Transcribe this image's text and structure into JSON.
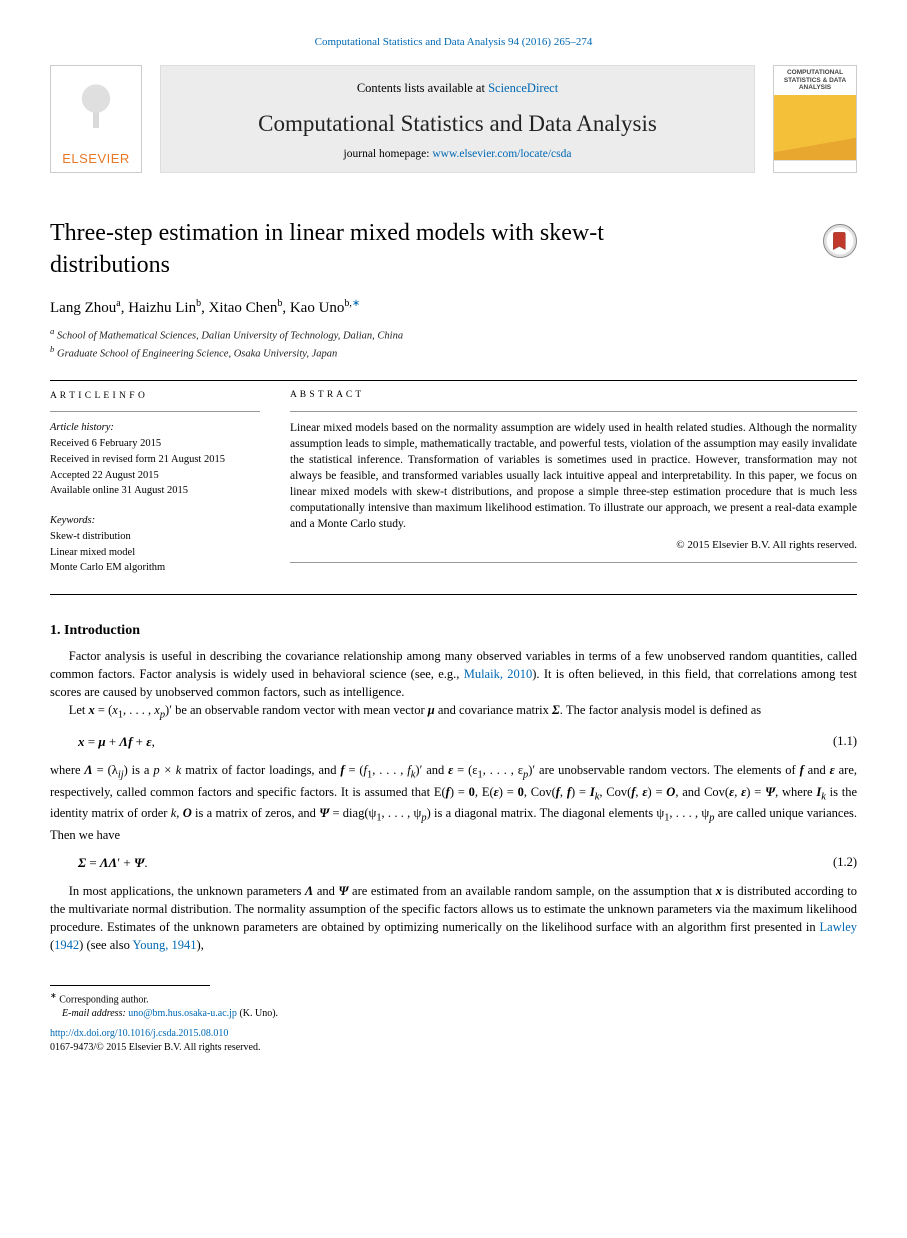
{
  "header_link": "Computational Statistics and Data Analysis 94 (2016) 265–274",
  "banner": {
    "elsevier_word": "ELSEVIER",
    "contents_prefix": "Contents lists available at ",
    "contents_link": "ScienceDirect",
    "journal_name": "Computational Statistics and Data Analysis",
    "homepage_prefix": "journal homepage: ",
    "homepage_link": "www.elsevier.com/locate/csda",
    "cover_text": "COMPUTATIONAL STATISTICS & DATA ANALYSIS"
  },
  "title": "Three-step estimation in linear mixed models with skew-t distributions",
  "authors": {
    "a1_name": "Lang Zhou",
    "a1_sup": "a",
    "a2_name": "Haizhu Lin",
    "a2_sup": "b",
    "a3_name": "Xitao Chen",
    "a3_sup": "b",
    "a4_name": "Kao Uno",
    "a4_sup": "b,",
    "a4_star": "∗"
  },
  "affiliations": {
    "a": "School of Mathematical Sciences, Dalian University of Technology, Dalian, China",
    "b": "Graduate School of Engineering Science, Osaka University, Japan"
  },
  "history": {
    "header": "A R T I C L E   I N F O",
    "line1": "Article history:",
    "line2": "Received 6 February 2015",
    "line3": "Received in revised form 21 August 2015",
    "line4": "Accepted 22 August 2015",
    "line5": "Available online 31 August 2015",
    "kw_header": "Keywords:",
    "kw1": "Skew-t distribution",
    "kw2": "Linear mixed model",
    "kw3": "Monte Carlo EM algorithm"
  },
  "abstract": {
    "header": "A B S T R A C T",
    "text": "Linear mixed models based on the normality assumption are widely used in health related studies. Although the normality assumption leads to simple, mathematically tractable, and powerful tests, violation of the assumption may easily invalidate the statistical inference. Transformation of variables is sometimes used in practice. However, transformation may not always be feasible, and transformed variables usually lack intuitive appeal and interpretability. In this paper, we focus on linear mixed models with skew-t distributions, and propose a simple three-step estimation procedure that is much less computationally intensive than maximum likelihood estimation. To illustrate our approach, we present a real-data example and a Monte Carlo study.",
    "copyright": "© 2015 Elsevier B.V. All rights reserved."
  },
  "section1": {
    "heading": "1. Introduction",
    "p1a": "Factor analysis is useful in describing the covariance relationship among many observed variables in terms of a few unobserved random quantities, called common factors. Factor analysis is widely used in behavioral science (see, e.g., ",
    "p1_cite1": "Mulaik, 2010",
    "p1b": "). It is often believed, in this field, that correlations among test scores are caused by unobserved common factors, such as intelligence."
  },
  "model": {
    "intro": "Let ",
    "x_def": " be an observable random vector with mean vector ",
    "mu_sym": "μ",
    "cov_sym": " and covariance matrix ",
    "sigma_sym": "Σ",
    "model_text": ". The factor analysis model is defined as",
    "eq": "x = μ + Λf + ε,",
    "eq_num": "(1.1)"
  },
  "p2": {
    "a": "where ",
    "lambda": "Λ = (λij)",
    "b": " is a ",
    "pk": "p × k",
    "c": " matrix of factor loadings, and ",
    "f": "f = (f1, . . . , fk)′",
    "d": " and ",
    "eps": "ε = (ε1, . . . , εp)′",
    "e": " are unobservable random vectors. The elements of ",
    "f2": "f",
    "g": " and ",
    "eps2": "ε",
    "h": " are, respectively, called common factors and specific factors. It is assumed that ",
    "ef": "E(f) = 0",
    "comma1": ", ",
    "ee": "E(ε) = 0",
    "comma2": ", ",
    "cff": "Cov(f, f) = Ik",
    "comma3": ", ",
    "cfe": "Cov(f, ε) = O",
    "and": ", and ",
    "cee": "Cov(ε, ε) = Ψ",
    "i": ", where ",
    "ik": "Ik",
    "j": " is the identity matrix of order ",
    "k": "k",
    "comma4": ", ",
    "O": "O",
    "k2": " is a matrix of zeros, and ",
    "psi": "Ψ = diag(ψ1, . . . , ψp)",
    "l": " is a diagonal matrix. The diagonal elements ",
    "psi_i": "ψ1, . . . , ψp",
    "m": " are called unique variances. Then we have"
  },
  "eq2": {
    "eq": "Σ = ΛΛ′ + Ψ.",
    "num": "(1.2)"
  },
  "p3": {
    "a": "In most applications, the unknown parameters ",
    "lambda": "Λ",
    "b": " and ",
    "psi": "Ψ",
    "c": " are estimated from an available random sample, on the assumption that ",
    "x": "x",
    "d": " is distributed according to the multivariate normal distribution. The normality assumption of the specific factors allows us to estimate the unknown parameters via the maximum likelihood procedure. Estimates of the unknown parameters are obtained by optimizing numerically on the likelihood surface with an algorithm first presented in ",
    "cite1": "Lawley",
    "yr1": " (",
    "yr1n": "1942",
    "yr1c": ")",
    "e": " (see also ",
    "cite2": "Young, 1941",
    "f": "),"
  },
  "footnote": {
    "star": "∗",
    "label": " Corresponding author.",
    "email_label": "E-mail address: ",
    "email": "uno@bm.hus.osaka-u.ac.jp",
    "email_suffix": " (K. Uno)."
  },
  "doi": {
    "url": "http://dx.doi.org/10.1016/j.csda.2015.08.010",
    "tail": "0167-9473/© 2015 Elsevier B.V. All rights reserved."
  }
}
